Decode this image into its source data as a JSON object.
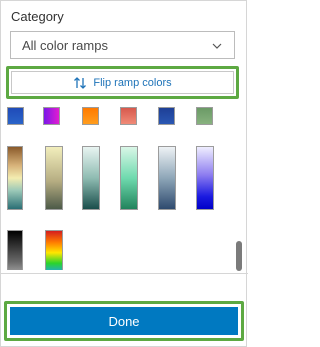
{
  "category": {
    "label": "Category",
    "selected": "All color ramps"
  },
  "flip_button": {
    "label": "Flip ramp colors",
    "icon": "swap-vertical-icon"
  },
  "done_button": {
    "label": "Done"
  },
  "ramps": [
    {
      "name": "ramp-blue",
      "gradient": "linear-gradient(#1f4bb8,#2a64c8)"
    },
    {
      "name": "ramp-purple-magenta",
      "gradient": "linear-gradient(90deg,#7a18e8,#e21cd1)"
    },
    {
      "name": "ramp-orange",
      "gradient": "linear-gradient(#ff7a00,#ff9d1e)"
    },
    {
      "name": "ramp-red-salmon",
      "gradient": "linear-gradient(#d7594d,#f08b78)"
    },
    {
      "name": "ramp-navy",
      "gradient": "linear-gradient(#1e3f96,#2a57b3)"
    },
    {
      "name": "ramp-olive-green",
      "gradient": "linear-gradient(#6b9a66,#88b27f)"
    },
    {
      "name": "ramp-brown-yellow-teal",
      "gradient": "linear-gradient(#8a5a2b,#d8b37a 30%,#f3ecb0 50%,#9cc9b8 70%,#2a6f75)"
    },
    {
      "name": "ramp-cream-olive",
      "gradient": "linear-gradient(#f2eebc,#b6ad82 55%,#4d5a48)"
    },
    {
      "name": "ramp-white-dark-teal",
      "gradient": "linear-gradient(#e8f4f1,#8fbcb2 50%,#1a4e4b)"
    },
    {
      "name": "ramp-mint-green",
      "gradient": "linear-gradient(#d9f6e7,#6fdaae 50%,#21835c)"
    },
    {
      "name": "ramp-grey-blue",
      "gradient": "linear-gradient(#eef2f5,#8ea6b8 50%,#2e4a6e)"
    },
    {
      "name": "ramp-lavender-blue",
      "gradient": "linear-gradient(#efeeff,#8d7df0 45%,#1a1ae0 80%,#0000c8)"
    },
    {
      "name": "ramp-black-white",
      "gradient": "linear-gradient(#000000,#6a6a6a 50%,#ffffff)"
    },
    {
      "name": "ramp-rainbow",
      "gradient": "linear-gradient(#d41e1e,#ff7a00 18%,#ffe600 35%,#2bd42b 52%,#1e9eff 70%,#2a2ad6 85%,#b21ec8)"
    }
  ]
}
